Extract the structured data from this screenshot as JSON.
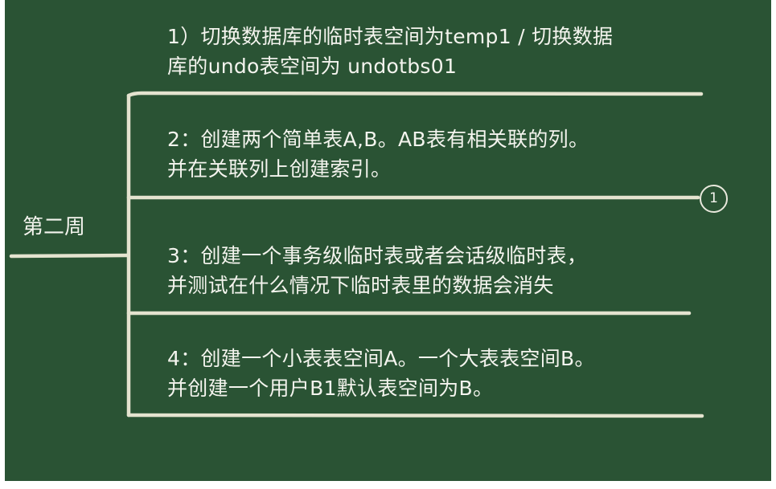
{
  "root": {
    "label": "第二周"
  },
  "branches": [
    {
      "line1": "1）切换数据库的临时表空间为temp1 / 切换数据",
      "line2": "库的undo表空间为 undotbs01"
    },
    {
      "line1": "2：创建两个简单表A,B。AB表有相关联的列。",
      "line2": "并在关联列上创建索引。"
    },
    {
      "line1": "3：创建一个事务级临时表或者会话级临时表，",
      "line2": "并测试在什么情况下临时表里的数据会消失"
    },
    {
      "line1": "4：创建一个小表表空间A。一个大表表空间B。",
      "line2": "并创建一个用户B1默认表空间为B。"
    }
  ],
  "marker": {
    "label": "1"
  },
  "colors": {
    "board": "#2a5334",
    "chalk": "#f4f4ee",
    "line": "#e4e3cf"
  }
}
